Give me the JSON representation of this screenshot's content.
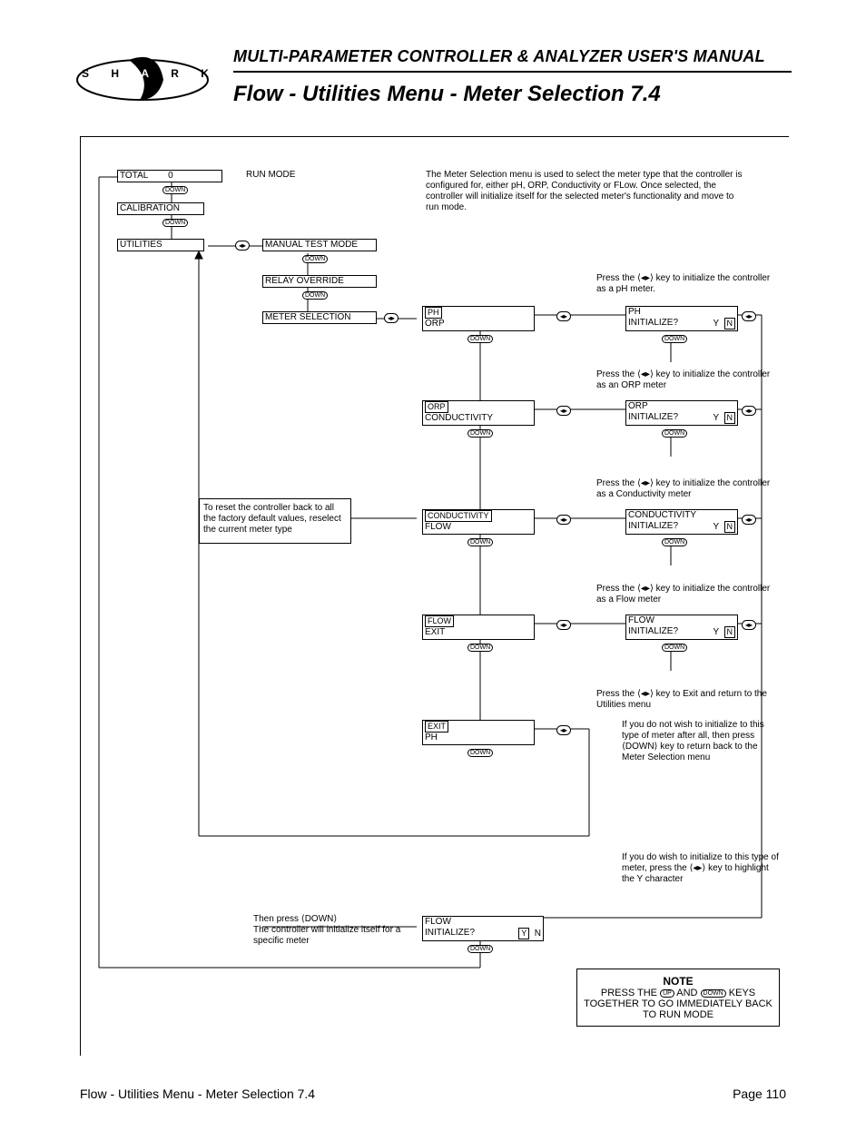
{
  "header": {
    "manual": "MULTI-PARAMETER CONTROLLER & ANALYZER USER'S MANUAL",
    "title": "Flow - Utilities Menu - Meter Selection 7.4",
    "logo_letters": {
      "s": "S",
      "h": "H",
      "a": "A",
      "r": "R",
      "k": "K"
    }
  },
  "footer": {
    "left": "Flow - Utilities Menu - Meter Selection 7.4",
    "right": "Page 110"
  },
  "intro": "The Meter Selection menu is used to select the meter type that the controller is configured for, either pH, ORP, Conductivity or FLow. Once selected, the controller will initialize itself for the selected meter's functionality and move to run mode.",
  "left_col": {
    "total_label": "TOTAL",
    "total_value": "0",
    "run_mode": "RUN MODE",
    "calibration": "CALIBRATION",
    "utilities": "UTILITIES",
    "manual_test": "MANUAL TEST MODE",
    "relay_override": "RELAY OVERRIDE",
    "meter_selection": "METER SELECTION"
  },
  "reset_note": "To reset the controller back to all the factory default values, reselect the current meter type",
  "ph_hint": "Press the  ⟨◂▸⟩  key to initialize the controller as a pH meter.",
  "orp_hint": "Press the  ⟨◂▸⟩  key to initialize the controller as an ORP meter",
  "cond_hint": "Press the  ⟨◂▸⟩  key to initialize the controller as a Conductivity meter",
  "flow_hint": "Press the  ⟨◂▸⟩  key to initialize the controller as a Flow meter",
  "exit_hint": "Press the  ⟨◂▸⟩  key to Exit and return to the Utilities menu",
  "noinit_hint": "If you do not wish to initialize to this type of meter after all, then press  ⟨DOWN⟩ key to return back to the Meter Selection menu",
  "doinit_hint": "If you do wish to initialize to this type of meter, press the  ⟨◂▸⟩  key to highlight the Y character",
  "then_press": "Then press ⟨DOWN⟩\nThe controller will initialize itself for a specific meter",
  "menus": {
    "ph": {
      "line1": "PH",
      "line2": "ORP"
    },
    "orp": {
      "line1": "ORP",
      "line2": "CONDUCTIVITY"
    },
    "cond": {
      "line1": "CONDUCTIVITY",
      "line2": "FLOW"
    },
    "flow": {
      "line1": "FLOW",
      "line2": "EXIT"
    },
    "exit": {
      "line1": "EXIT",
      "line2": "PH"
    }
  },
  "confirm": {
    "ph": {
      "line1": "PH",
      "line2": "INITIALIZE?",
      "yn": "Y  N"
    },
    "orp": {
      "line1": "ORP",
      "line2": "INITIALIZE?",
      "yn": "Y  N"
    },
    "cond": {
      "line1": "CONDUCTIVITY",
      "line2": "INITIALIZE?",
      "yn": "Y  N"
    },
    "flow": {
      "line1": "FLOW",
      "line2": "INITIALIZE?",
      "yn": "Y  N"
    },
    "final": {
      "line1": "FLOW",
      "line2": "INITIALIZE?",
      "yn": "Y  N"
    }
  },
  "note": {
    "title": "NOTE",
    "body1": "PRESS THE ",
    "up": "UP",
    "and": " AND ",
    "down": "DOWN",
    "body2": " KEYS TOGETHER TO GO IMMEDIATELY BACK TO RUN MODE"
  }
}
